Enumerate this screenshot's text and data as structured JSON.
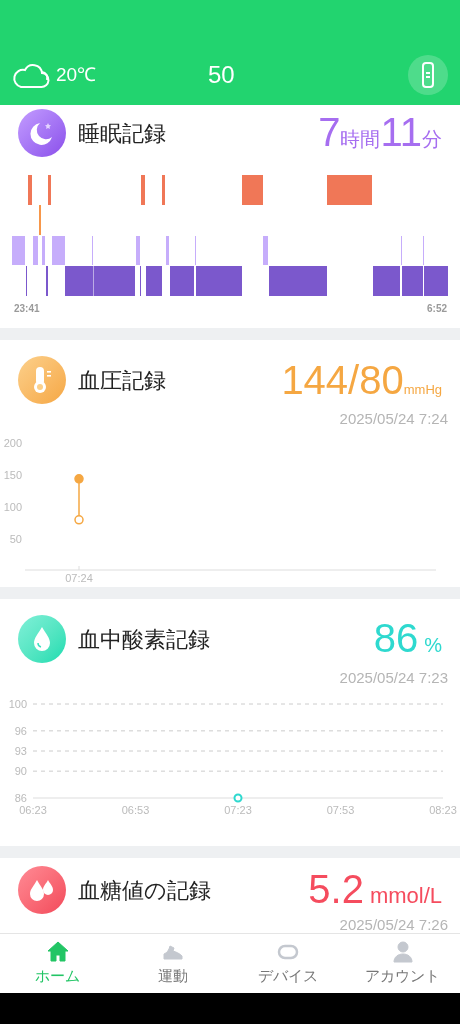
{
  "header": {
    "weather": "20℃",
    "center_value": "50"
  },
  "sleep": {
    "title": "睡眠記録",
    "hours": "7",
    "hours_unit": "時間",
    "minutes": "11",
    "minutes_unit": "分",
    "start_time": "23:41",
    "end_time": "6:52"
  },
  "blood_pressure": {
    "title": "血圧記録",
    "value": "144/80",
    "unit": "mmHg",
    "timestamp": "2025/05/24 7:24",
    "chart_data": {
      "type": "scatter",
      "categories": [
        "07:24"
      ],
      "yticks": [
        50,
        100,
        150,
        200
      ],
      "ylim": [
        0,
        200
      ],
      "series": [
        {
          "color": "#f5a742",
          "marker": "o",
          "values": [
            144
          ]
        },
        {
          "color": "#f5a742",
          "marker": "o",
          "values": [
            80
          ]
        }
      ]
    }
  },
  "blood_oxygen": {
    "title": "血中酸素記録",
    "value": "86",
    "unit": "%",
    "timestamp": "2025/05/24 7:23",
    "chart_data": {
      "type": "scatter",
      "categories": [
        "06:23",
        "06:53",
        "07:23",
        "07:53",
        "08:23"
      ],
      "yticks": [
        86,
        90,
        93,
        96,
        100
      ],
      "ylim": [
        86,
        100
      ],
      "grid": true,
      "series": [
        {
          "color": "#2ed9cf",
          "values": [
            null,
            null,
            86,
            null,
            null
          ]
        }
      ]
    }
  },
  "blood_glucose": {
    "title": "血糖値の記録",
    "value": "5.2",
    "unit": "mmol/L",
    "timestamp": "2025/05/24 7:26"
  },
  "bottom_nav": [
    {
      "label": "ホーム",
      "selected": true
    },
    {
      "label": "運動",
      "selected": false
    },
    {
      "label": "デバイス",
      "selected": false
    },
    {
      "label": "アカウント",
      "selected": false
    }
  ]
}
